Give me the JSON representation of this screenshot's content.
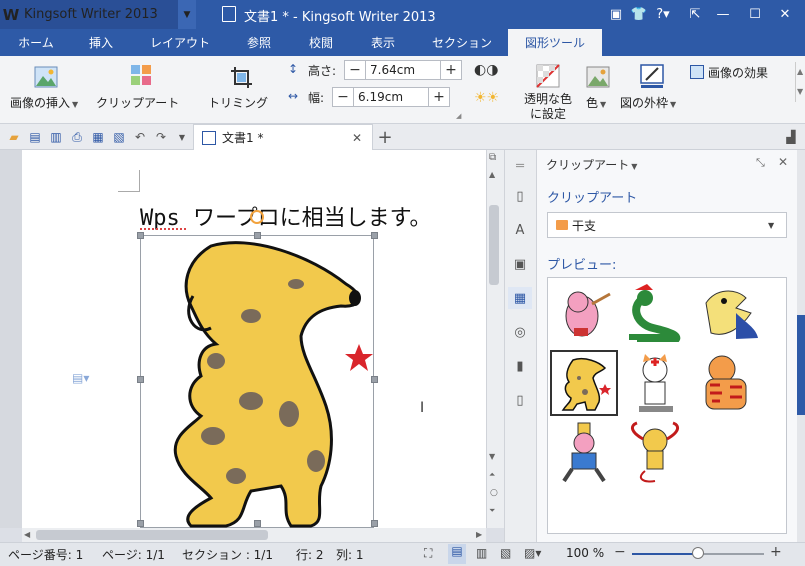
{
  "app": {
    "name": "Kingsoft Writer 2013",
    "window_title": "文書1 * - Kingsoft Writer 2013"
  },
  "ribbon_tabs": [
    {
      "label": "ホーム"
    },
    {
      "label": "挿入"
    },
    {
      "label": "レイアウト"
    },
    {
      "label": "参照"
    },
    {
      "label": "校閲"
    },
    {
      "label": "表示"
    },
    {
      "label": "セクション"
    },
    {
      "label": "図形ツール",
      "active": true
    }
  ],
  "ribbon": {
    "insert_image": "画像の挿入",
    "clip_art": "クリップアート",
    "trimming": "トリミング",
    "height_label": "高さ:",
    "height_value": "7.64cm",
    "width_label": "幅:",
    "width_value": "6.19cm",
    "transparent_color_line1": "透明な色",
    "transparent_color_line2": "に設定",
    "color": "色",
    "image_outline": "図の外枠",
    "image_effects": "画像の効果"
  },
  "document_tab": {
    "label": "文書1 *"
  },
  "document": {
    "heading": "Wps ワープロに相当します。"
  },
  "clipart_panel": {
    "header": "クリップアート",
    "section_title": "クリップアート",
    "category": "干支",
    "preview_label": "プレビュー:",
    "items": [
      "pig",
      "snake",
      "dragon",
      "dog",
      "cat",
      "tiger",
      "horse",
      "monkey"
    ],
    "selected_item": "dog"
  },
  "status_bar": {
    "page_number": "ページ番号: 1",
    "page": "ページ: 1/1",
    "section": "セクション : 1/1",
    "row": "行: 2",
    "column": "列: 1",
    "zoom": "100 %"
  },
  "colors": {
    "title_bar": "#2e5aa7",
    "accent": "#2d57a5",
    "star": "#d9252b",
    "dog": "#f2c94c"
  }
}
